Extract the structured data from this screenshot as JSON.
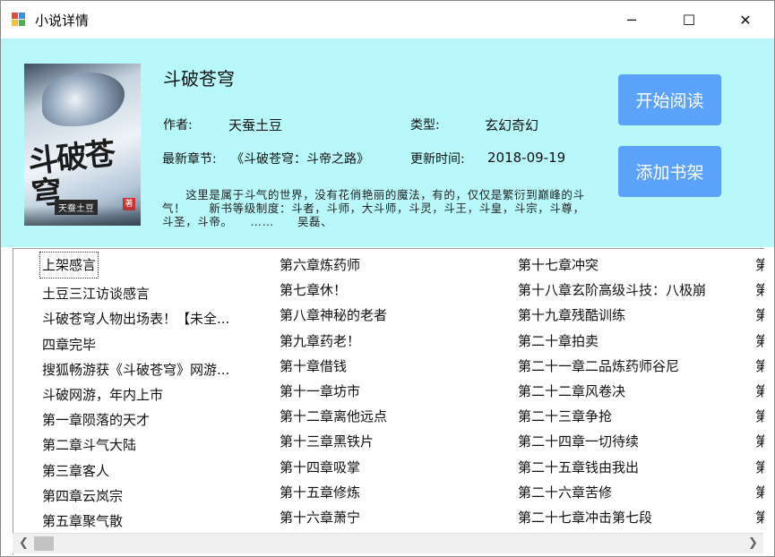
{
  "window": {
    "title": "小说详情",
    "controls": {
      "minimize": "─",
      "maximize": "☐",
      "close": "✕"
    }
  },
  "book": {
    "title": "斗破苍穹",
    "author_label": "作者:",
    "author": "天蚕土豆",
    "genre_label": "类型:",
    "genre": "玄幻奇幻",
    "latest_label": "最新章节:",
    "latest": "《斗破苍穹：斗帝之路》",
    "updated_label": "更新时间:",
    "updated": "2018-09-19",
    "description": "　　这里是属于斗气的世界，没有花俏艳丽的魔法，有的，仅仅是繁衍到巅峰的斗气！　　新书等级制度：斗者，斗师，大斗师，斗灵，斗王，斗皇，斗宗，斗尊，斗圣，斗帝。　　……　　吴磊、",
    "cover": {
      "title_art": "斗破苍穹",
      "author_art": "天蚕土豆",
      "seal": "著"
    }
  },
  "buttons": {
    "start_reading": "开始阅读",
    "add_shelf": "添加书架"
  },
  "chapters": {
    "col1": [
      "上架感言",
      "土豆三江访谈感言",
      "斗破苍穹人物出场表！【未全...",
      "四章完毕",
      "搜狐畅游获《斗破苍穹》网游...",
      "斗破网游，年内上市",
      "第一章陨落的天才",
      "第二章斗气大陆",
      "第三章客人",
      "第四章云岚宗",
      "第五章聚气散"
    ],
    "col2": [
      "第六章炼药师",
      "第七章休！",
      "第八章神秘的老者",
      "第九章药老！",
      "第十章借钱",
      "第十一章坊市",
      "第十二章离他远点",
      "第十三章黑铁片",
      "第十四章吸掌",
      "第十五章修炼",
      "第十六章萧宁"
    ],
    "col3": [
      "第十七章冲突",
      "第十八章玄阶高级斗技：八极崩",
      "第十九章残酷训练",
      "第二十章拍卖",
      "第二十一章二品炼药师谷尼",
      "第二十二章风卷决",
      "第二十三章争抢",
      "第二十四章一切待续",
      "第二十五章钱由我出",
      "第二十六章苦修",
      "第二十七章冲击第七段"
    ],
    "col4": [
      "第",
      "第",
      "第",
      "第",
      "第",
      "第",
      "第",
      "第",
      "第",
      "第",
      "第"
    ]
  },
  "scrollbar": {
    "left": "❮",
    "right": "❯"
  },
  "colors": {
    "header_bg": "#b9f8fa",
    "button_bg": "#5aa2fa",
    "button_text": "#ffffff"
  }
}
